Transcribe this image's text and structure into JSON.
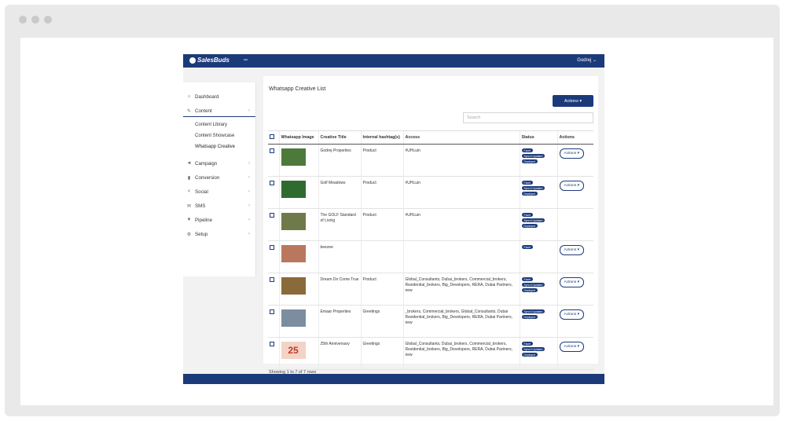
{
  "app": {
    "logo_text": "SalesBuds",
    "menu_icon": "hamburger-icon",
    "user_name": "Godrej ⌄"
  },
  "sidebar": {
    "items": [
      {
        "label": "Dashboard",
        "icon": "home-icon"
      },
      {
        "label": "Content",
        "icon": "edit-icon"
      },
      {
        "label": "Campaign",
        "icon": "megaphone-icon"
      },
      {
        "label": "Conversion",
        "icon": "bar-chart-icon"
      },
      {
        "label": "Social",
        "icon": "share-icon"
      },
      {
        "label": "SMS",
        "icon": "mail-icon"
      },
      {
        "label": "Pipeline",
        "icon": "filter-icon"
      },
      {
        "label": "Setup",
        "icon": "gear-icon"
      }
    ],
    "subitems": [
      "Content Library",
      "Content Showcase",
      "Whatsapp Creative"
    ],
    "chevron": "‹"
  },
  "page": {
    "title": "Whatsapp Creative List",
    "actions_label": "Actions ▾",
    "search_placeholder": "Search",
    "showing_prefix": "Showing",
    "showing_highlight": "1",
    "showing_suffix": "to 7 of 7 rows"
  },
  "table": {
    "headers": [
      "Whatsapp Image",
      "Creative Title",
      "Internal hashtag(s)",
      "Access",
      "Status",
      "Actions"
    ],
    "row_action_label": "Actions ▾",
    "rows": [
      {
        "title": "Godrej Properties",
        "hashtag": "Product",
        "access": "#UHLuin",
        "status": [
          "Facet",
          "Sync'd Updated",
          "Deployed"
        ],
        "action": "Actions ▾",
        "thumb_color": "#4d7a3a"
      },
      {
        "title": "Golf Meadows",
        "hashtag": "Product",
        "access": "#UHLuin",
        "status": [
          "Facet",
          "Sync'd Updated",
          "Deployed"
        ],
        "action": "Actions ▾",
        "thumb_color": "#2f6b2f"
      },
      {
        "title": "The GOLF Standard of Living",
        "hashtag": "Product",
        "access": "#UHLuin",
        "status": [
          "Facet",
          "Sync'd Updated",
          "Deployed"
        ],
        "action": "",
        "thumb_color": "#6e7a4a"
      },
      {
        "title": "beezee",
        "hashtag": "",
        "access": "",
        "status": [
          "Facet"
        ],
        "action": "Actions ▾",
        "thumb_color": "#b9775e"
      },
      {
        "title": "Dream Do Come True",
        "hashtag": "Product",
        "access": "Global_Consultants, Dubai_brokers, Commercial_brokers, Residential_brokers, Big_Developers, RERA, Dubai Partners, new",
        "status": [
          "Facet",
          "Sync'd Updated",
          "Deployed"
        ],
        "action": "Actions ▾",
        "thumb_color": "#8a6a3a"
      },
      {
        "title": "Emaar Properties",
        "hashtag": "Greetings",
        "access": "_brokers, Commercial_brokers, Global_Consultants, Dubai Residential_brokers, Big_Developers, RERA, Dubai Partners, new",
        "status": [
          "Sync'd Updated",
          "Deployed"
        ],
        "action": "Actions ▾",
        "thumb_color": "#7d8da0"
      },
      {
        "title": "25th Anniversary",
        "hashtag": "Greetings",
        "access": "Global_Consultants, Dubai_brokers, Commercial_brokers, Residential_brokers, Big_Developers, RERA, Dubai Partners, new",
        "status": [
          "Facet",
          "Sync'd Updated",
          "Deployed"
        ],
        "action": "Actions ▾",
        "thumb_color": "#f3d3c6",
        "thumb_text": "25"
      }
    ]
  },
  "colors": {
    "brand": "#1b3a7a",
    "frame": "#e9e9e9"
  }
}
